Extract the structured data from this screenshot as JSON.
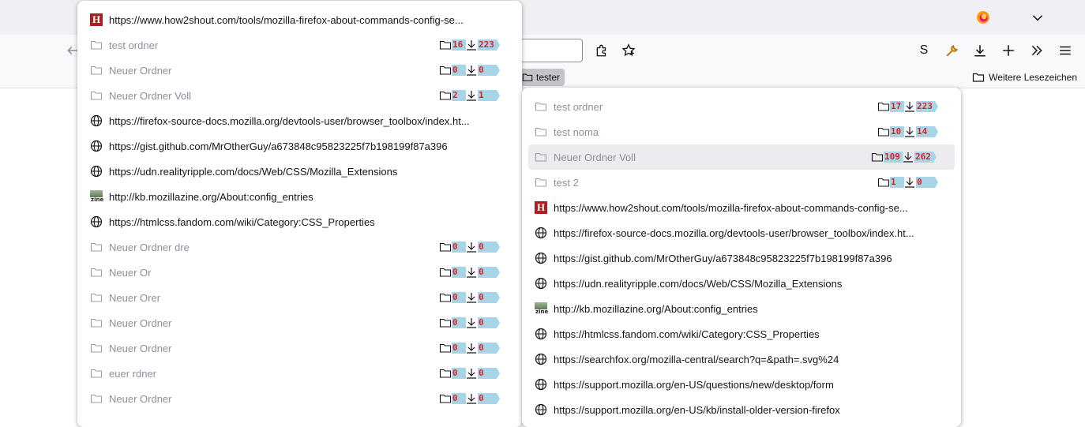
{
  "toolbar": {
    "s_label": "S",
    "bookmarks": {
      "tester": "tester",
      "other": "Weitere Lesezeichen"
    }
  },
  "popup_left": [
    {
      "type": "link",
      "icon": "h",
      "label": "https://www.how2shout.com/tools/mozilla-firefox-about-commands-config-se..."
    },
    {
      "type": "folder",
      "label": "test ordner",
      "folders": "16",
      "items": "223"
    },
    {
      "type": "folder",
      "label": "Neuer Ordner",
      "folders": "0",
      "items": "0"
    },
    {
      "type": "folder",
      "label": "Neuer Ordner Voll",
      "folders": "2",
      "items": "1"
    },
    {
      "type": "link",
      "icon": "globe",
      "label": "https://firefox-source-docs.mozilla.org/devtools-user/browser_toolbox/index.ht..."
    },
    {
      "type": "link",
      "icon": "globe",
      "label": "https://gist.github.com/MrOtherGuy/a673848c95823225f7b198199f87a396"
    },
    {
      "type": "link",
      "icon": "globe",
      "label": "https://udn.realityripple.com/docs/Web/CSS/Mozilla_Extensions"
    },
    {
      "type": "link",
      "icon": "zine",
      "label": "http://kb.mozillazine.org/About:config_entries"
    },
    {
      "type": "link",
      "icon": "globe",
      "label": "https://htmlcss.fandom.com/wiki/Category:CSS_Properties"
    },
    {
      "type": "folder",
      "label": "Neuer Ordner  dre",
      "folders": "0",
      "items": "0"
    },
    {
      "type": "folder",
      "label": "Neuer Or",
      "folders": "0",
      "items": "0"
    },
    {
      "type": "folder",
      "label": "Neuer Orer",
      "folders": "0",
      "items": "0"
    },
    {
      "type": "folder",
      "label": "Neuer Ordner",
      "folders": "0",
      "items": "0"
    },
    {
      "type": "folder",
      "label": "Neuer Ordner",
      "folders": "0",
      "items": "0"
    },
    {
      "type": "folder",
      "label": "euer rdner",
      "folders": "0",
      "items": "0"
    },
    {
      "type": "folder",
      "label": "Neuer Ordner",
      "folders": "0",
      "items": "0"
    }
  ],
  "popup_right": [
    {
      "type": "folder",
      "label": "test ordner",
      "folders": "17",
      "items": "223"
    },
    {
      "type": "folder",
      "label": "test noma",
      "folders": "10",
      "items": "14"
    },
    {
      "type": "folder",
      "label": "Neuer Ordner Voll",
      "folders": "109",
      "items": "262",
      "hover": true
    },
    {
      "type": "folder",
      "label": "test 2",
      "folders": "1",
      "items": "0"
    },
    {
      "type": "link",
      "icon": "h",
      "label": "https://www.how2shout.com/tools/mozilla-firefox-about-commands-config-se..."
    },
    {
      "type": "link",
      "icon": "globe",
      "label": "https://firefox-source-docs.mozilla.org/devtools-user/browser_toolbox/index.ht..."
    },
    {
      "type": "link",
      "icon": "globe",
      "label": "https://gist.github.com/MrOtherGuy/a673848c95823225f7b198199f87a396"
    },
    {
      "type": "link",
      "icon": "globe",
      "label": "https://udn.realityripple.com/docs/Web/CSS/Mozilla_Extensions"
    },
    {
      "type": "link",
      "icon": "zine",
      "label": "http://kb.mozillazine.org/About:config_entries"
    },
    {
      "type": "link",
      "icon": "globe",
      "label": "https://htmlcss.fandom.com/wiki/Category:CSS_Properties"
    },
    {
      "type": "link",
      "icon": "globe",
      "label": "https://searchfox.org/mozilla-central/search?q=&path=.svg%24"
    },
    {
      "type": "link",
      "icon": "globe",
      "label": "https://support.mozilla.org/en-US/questions/new/desktop/form"
    },
    {
      "type": "link",
      "icon": "globe",
      "label": "https://support.mozilla.org/en-US/kb/install-older-version-firefox"
    }
  ],
  "icon_glyphs": {
    "h": "H",
    "zine": "zine"
  },
  "colors": {
    "count_bg": "#a8d4e8",
    "count_text": "#e02020",
    "h_icon": "#b01c22"
  }
}
